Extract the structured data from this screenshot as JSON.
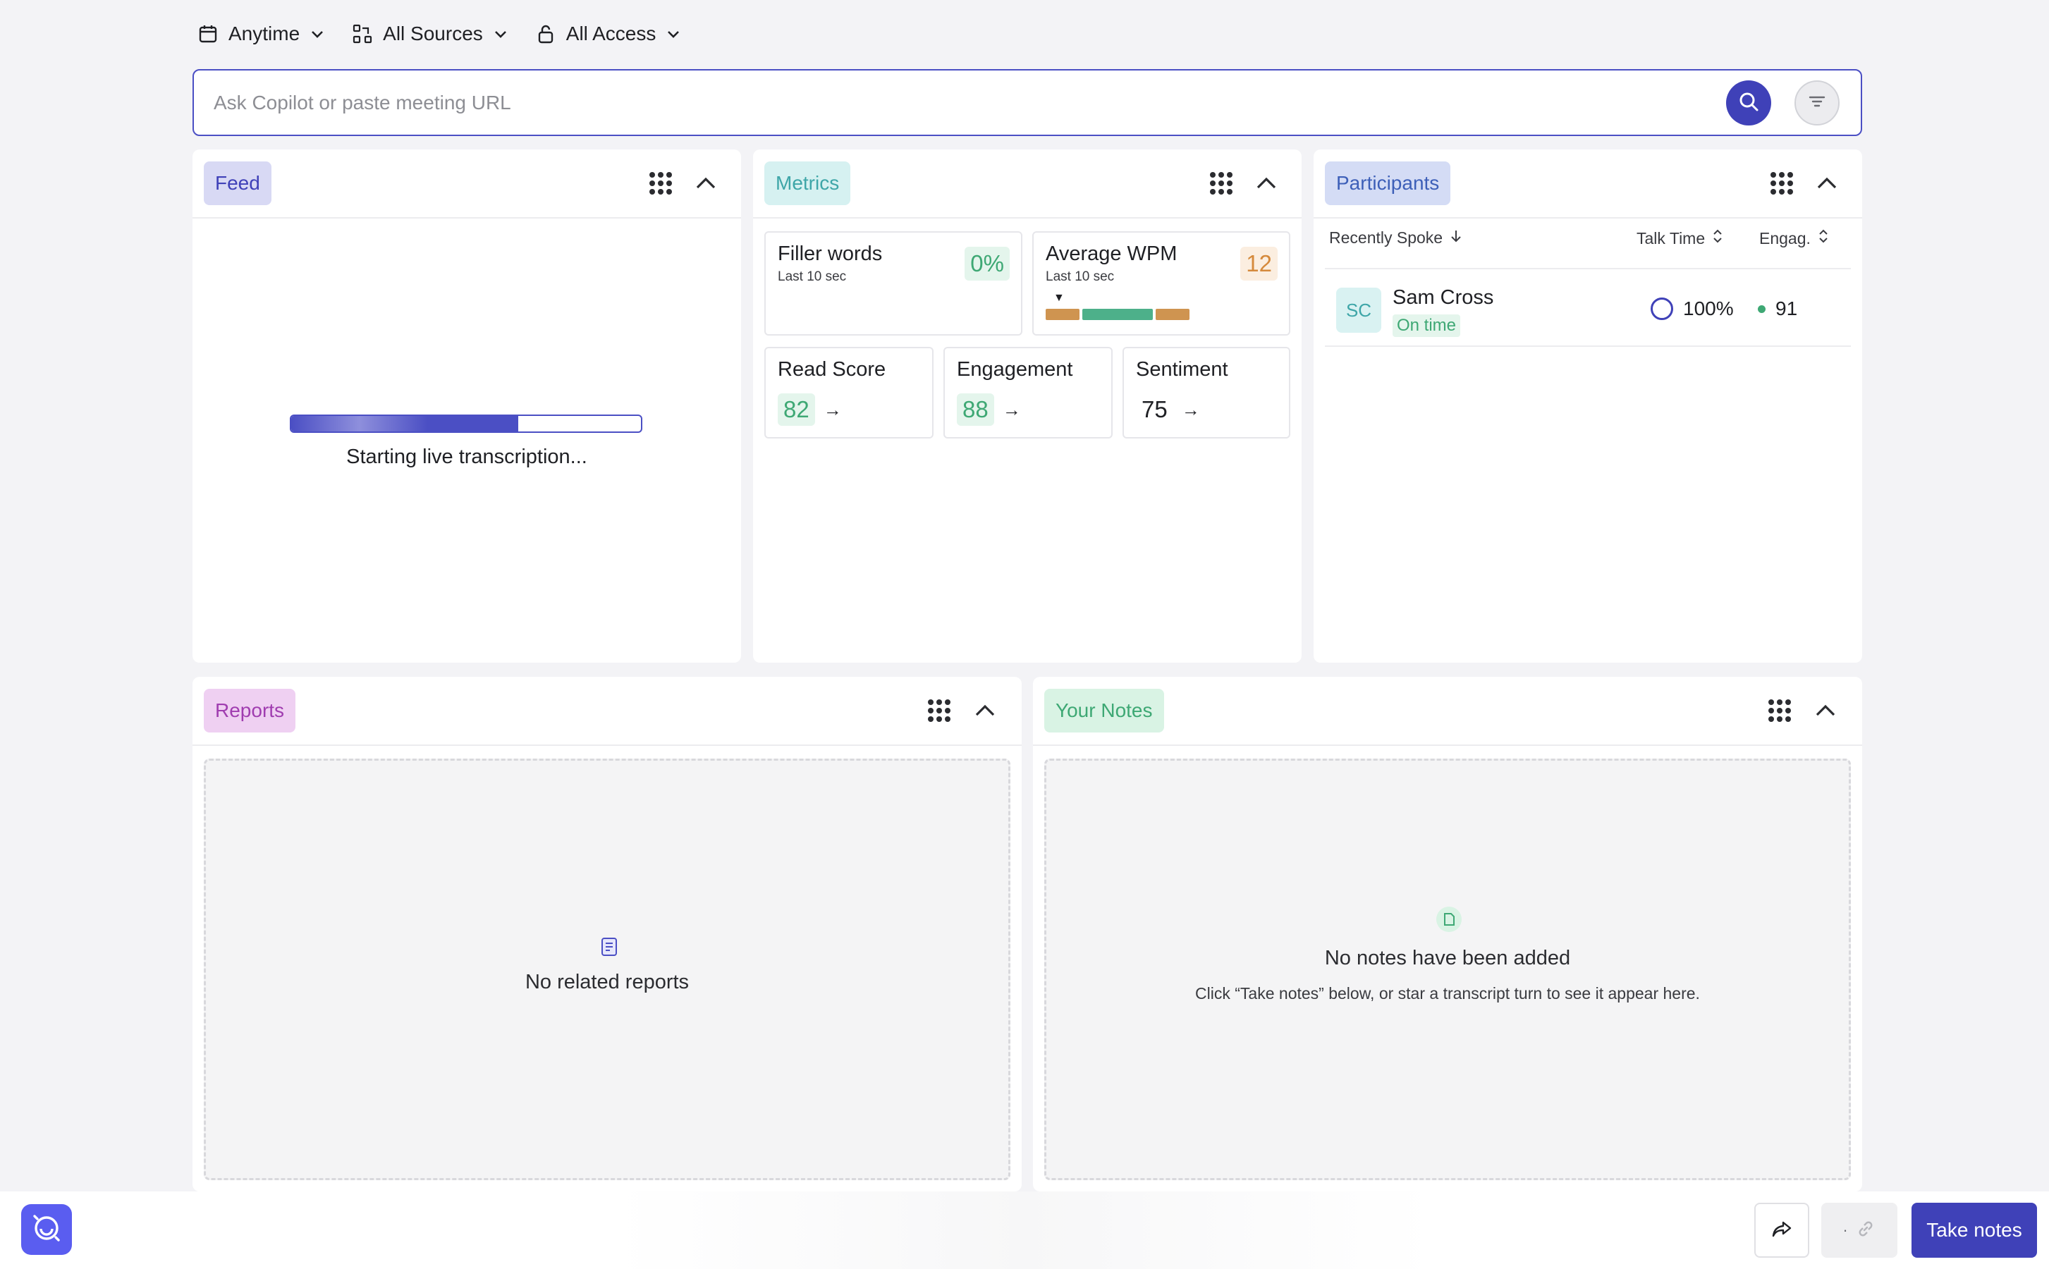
{
  "filters": {
    "time": {
      "label": "Anytime",
      "icon": "calendar-icon"
    },
    "sources": {
      "label": "All Sources",
      "icon": "sources-icon"
    },
    "access": {
      "label": "All Access",
      "icon": "lock-icon"
    }
  },
  "search": {
    "placeholder": "Ask Copilot or paste meeting URL",
    "value": ""
  },
  "colors": {
    "accent": "#3f41b8",
    "feed_pill_bg": "#d8d9f4",
    "feed_pill_fg": "#3f41b8",
    "metrics_pill_bg": "#d6f1f1",
    "metrics_pill_fg": "#3ea6a8",
    "participants_pill_bg": "#d4dcf5",
    "participants_pill_fg": "#3d5fb8",
    "reports_pill_bg": "#efd0f2",
    "reports_pill_fg": "#a03db0",
    "notes_pill_bg": "#d9f3e4",
    "notes_pill_fg": "#3ea874",
    "good": "#3ea874",
    "warn": "#d58a3c"
  },
  "feed": {
    "title": "Feed",
    "status": "Starting live transcription...",
    "progress": 0.65
  },
  "metrics": {
    "title": "Metrics",
    "filler": {
      "label": "Filler words",
      "sub": "Last 10 sec",
      "value": "0%"
    },
    "wpm": {
      "label": "Average WPM",
      "sub": "Last 10 sec",
      "value": "12",
      "marker": "▼"
    },
    "read": {
      "label": "Read Score",
      "value": "82",
      "arrow": "→"
    },
    "engagement": {
      "label": "Engagement",
      "value": "88",
      "arrow": "→"
    },
    "sentiment": {
      "label": "Sentiment",
      "value": "75",
      "arrow": "→"
    }
  },
  "participants": {
    "title": "Participants",
    "columns": {
      "spoke": "Recently Spoke",
      "talk": "Talk Time",
      "engag": "Engag."
    },
    "rows": [
      {
        "initials": "SC",
        "name": "Sam Cross",
        "status": "On time",
        "talk_time": "100%",
        "engagement": "91"
      }
    ]
  },
  "reports": {
    "title": "Reports",
    "empty_title": "No related reports",
    "icon": "report-icon"
  },
  "notes": {
    "title": "Your Notes",
    "empty_title": "No notes have been added",
    "empty_desc": "Click “Take notes” below, or star a transcript turn to see it appear here.",
    "icon": "note-icon"
  },
  "bottom": {
    "take_notes": "Take notes",
    "link_text": "·"
  }
}
